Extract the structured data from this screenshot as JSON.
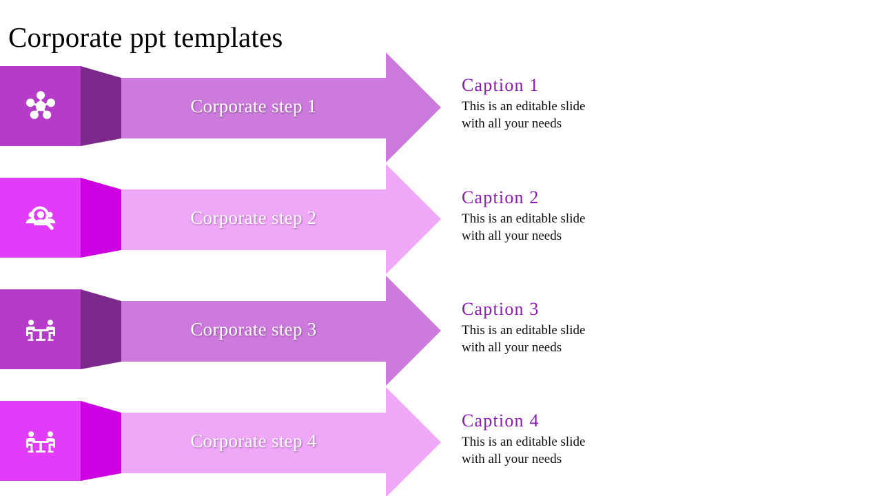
{
  "slide": {
    "title": "Corporate ppt templates",
    "background_color": "#ffffff",
    "title_color": "#000000"
  },
  "accent_colors": {
    "caption_purple": "#8E18B8",
    "body_text": "#0d0d0d"
  },
  "steps": [
    {
      "label": "Corporate step 1",
      "icon": "network-hub-people-icon",
      "box_color": "#B43CC8",
      "side_color": "#7B2A8C",
      "bar_color": "#CC7ADC",
      "head_color": "#CC7ADC"
    },
    {
      "label": "Corporate step 2",
      "icon": "people-search-icon",
      "box_color": "#E03CFA",
      "side_color": "#CC00E0",
      "bar_color": "#EFA8F8",
      "head_color": "#EFA8F8"
    },
    {
      "label": "Corporate step 3",
      "icon": "meeting-table-icon",
      "box_color": "#B43CC8",
      "side_color": "#7B2A8C",
      "bar_color": "#CC7ADC",
      "head_color": "#CC7ADC"
    },
    {
      "label": "Corporate step 4",
      "icon": "meeting-table-icon",
      "box_color": "#E03CFA",
      "side_color": "#CC00E0",
      "bar_color": "#EFA8F8",
      "head_color": "#EFA8F8"
    }
  ],
  "captions": [
    {
      "title": "Caption 1",
      "body": "This is an editable slide\nwith all your needs"
    },
    {
      "title": "Caption 2",
      "body": "This is an editable slide\nwith all your needs"
    },
    {
      "title": "Caption 3",
      "body": "This is an editable slide\nwith all your needs"
    },
    {
      "title": "Caption 4",
      "body": "This is an editable slide\nwith all your needs"
    }
  ]
}
